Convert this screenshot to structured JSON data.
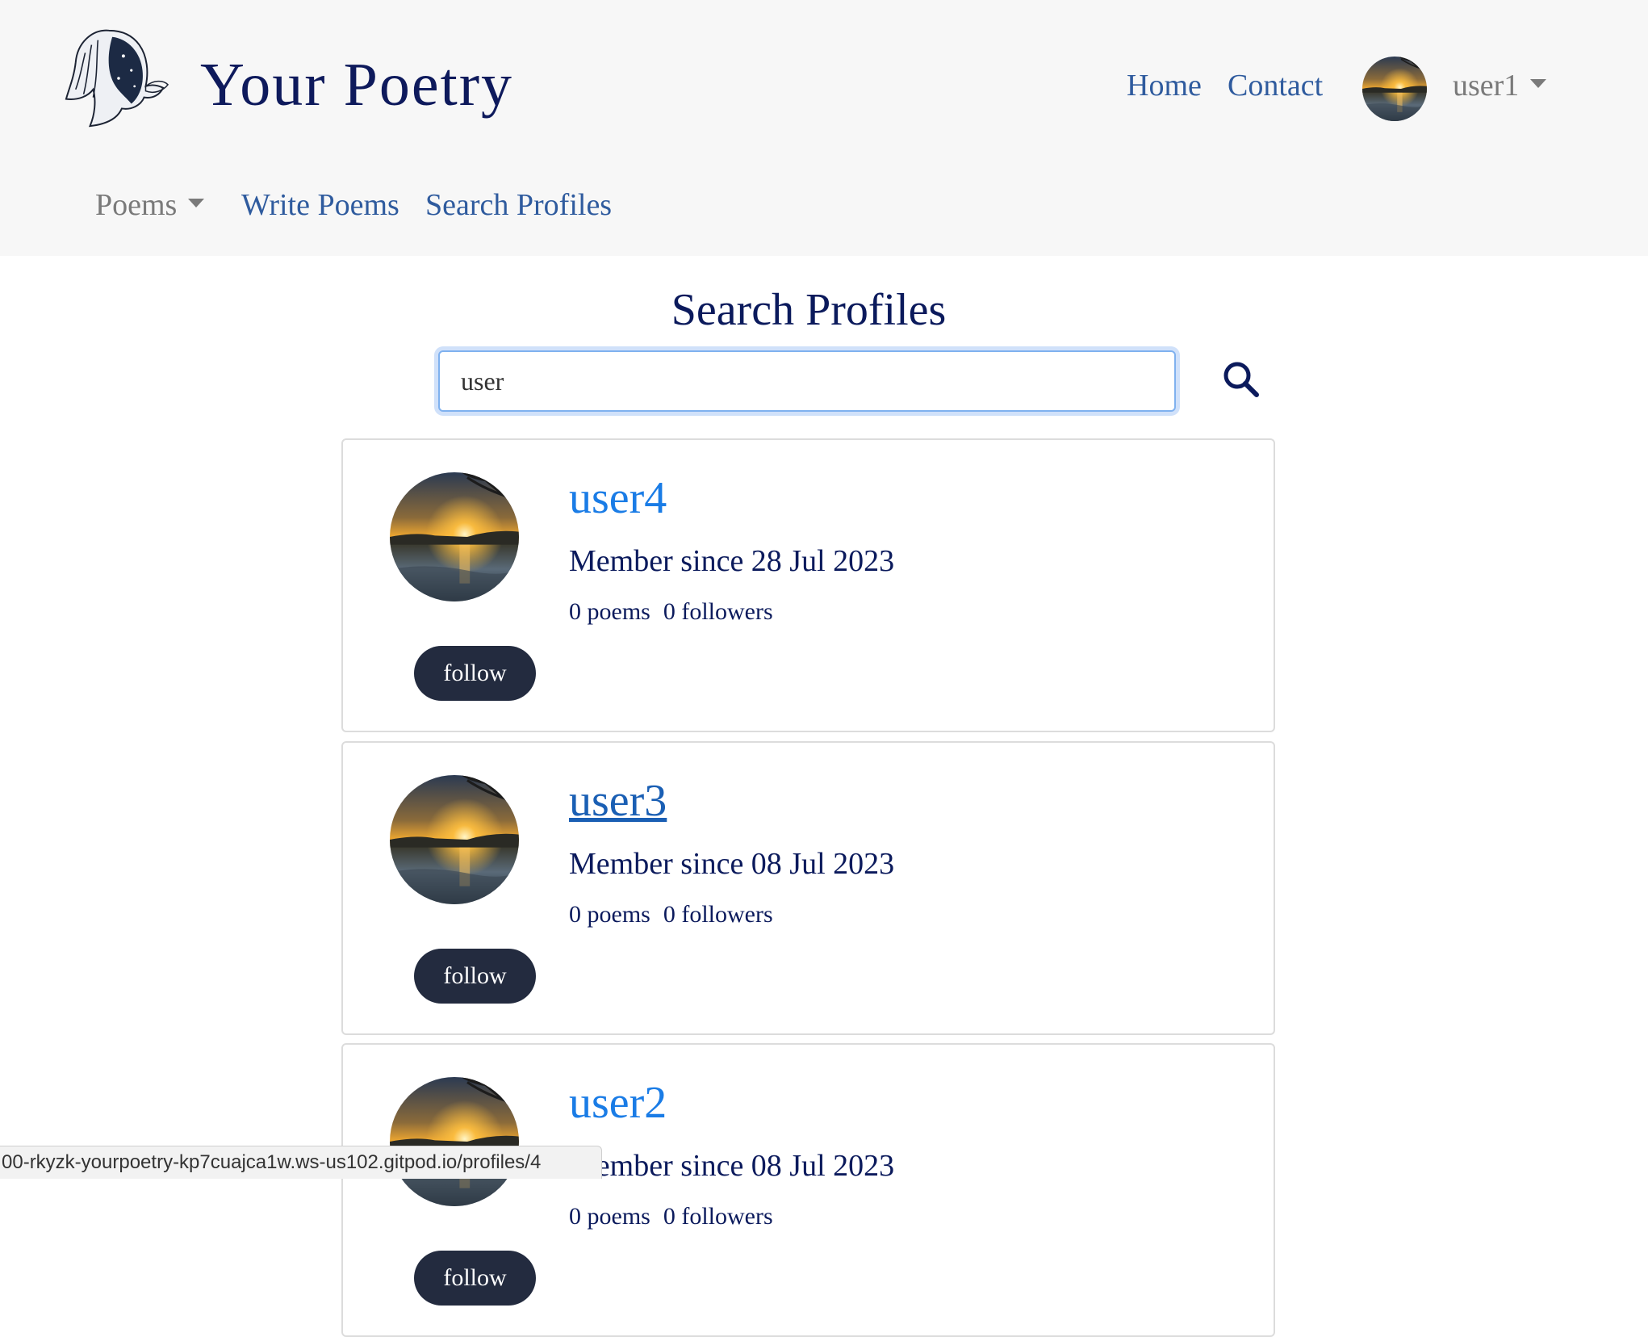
{
  "brand": {
    "title": "Your Poetry"
  },
  "nav": {
    "home": "Home",
    "contact": "Contact",
    "user": "user1",
    "poems": "Poems",
    "write": "Write Poems",
    "search": "Search Profiles"
  },
  "main": {
    "title": "Search Profiles",
    "search_value": "user"
  },
  "profiles": [
    {
      "name": "user4",
      "since": "Member since 28 Jul 2023",
      "poems": "0 poems",
      "followers": "0 followers",
      "follow": "follow"
    },
    {
      "name": "user3",
      "since": "Member since 08 Jul 2023",
      "poems": "0 poems",
      "followers": "0 followers",
      "follow": "follow"
    },
    {
      "name": "user2",
      "since": "Member since 08 Jul 2023",
      "poems": "0 poems",
      "followers": "0 followers",
      "follow": "follow"
    }
  ],
  "status": {
    "url": "00-rkyzk-yourpoetry-kp7cuajca1w.ws-us102.gitpod.io/profiles/4"
  },
  "colors": {
    "brand_navy": "#0e1a5c",
    "link_blue": "#1a7ce6",
    "follow_button": "#232b3f"
  },
  "icons": {
    "search": "search-icon",
    "logo": "poet-portrait-logo",
    "caret": "caret-down-icon"
  }
}
